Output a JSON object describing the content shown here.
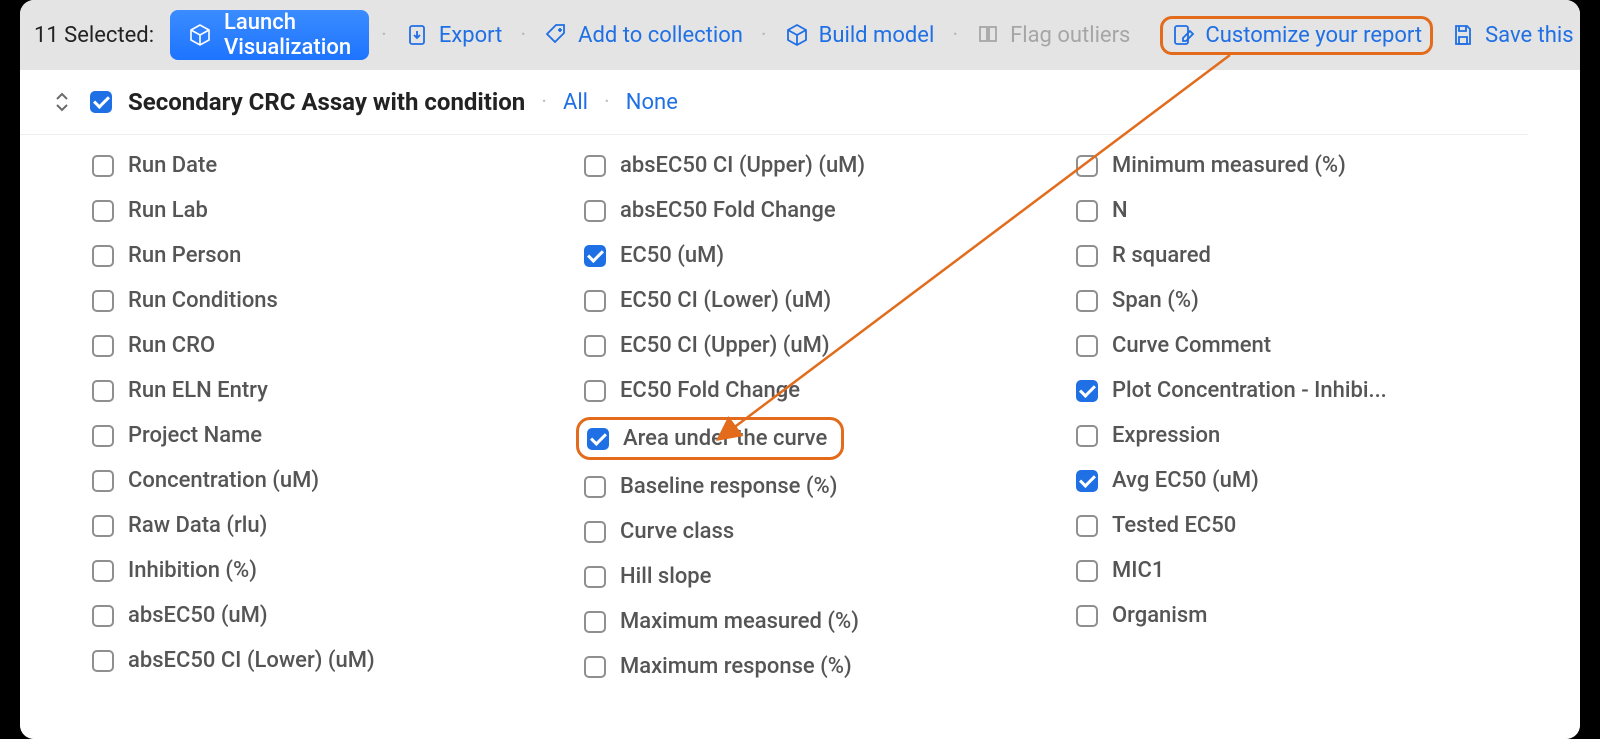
{
  "toolbar": {
    "selected_count": "11 Selected:",
    "launch": "Launch Visualization",
    "export": "Export",
    "add_collection": "Add to collection",
    "build_model": "Build model",
    "flag_outliers": "Flag outliers",
    "customize": "Customize your report",
    "save_search": "Save this search"
  },
  "section": {
    "title": "Secondary CRC Assay with condition",
    "all": "All",
    "none": "None",
    "checked": true
  },
  "cols": [
    [
      {
        "label": "Run Date",
        "checked": false
      },
      {
        "label": "Run Lab",
        "checked": false
      },
      {
        "label": "Run Person",
        "checked": false
      },
      {
        "label": "Run Conditions",
        "checked": false
      },
      {
        "label": "Run CRO",
        "checked": false
      },
      {
        "label": "Run ELN Entry",
        "checked": false
      },
      {
        "label": "Project Name",
        "checked": false
      },
      {
        "label": "Concentration (uM)",
        "checked": false
      },
      {
        "label": "Raw Data (rlu)",
        "checked": false
      },
      {
        "label": "Inhibition (%)",
        "checked": false
      },
      {
        "label": "absEC50 (uM)",
        "checked": false
      },
      {
        "label": "absEC50 CI (Lower) (uM)",
        "checked": false
      }
    ],
    [
      {
        "label": "absEC50 CI (Upper) (uM)",
        "checked": false
      },
      {
        "label": "absEC50 Fold Change",
        "checked": false
      },
      {
        "label": "EC50 (uM)",
        "checked": true
      },
      {
        "label": "EC50 CI (Lower) (uM)",
        "checked": false
      },
      {
        "label": "EC50 CI (Upper) (uM)",
        "checked": false
      },
      {
        "label": "EC50 Fold Change",
        "checked": false
      },
      {
        "label": "Area under the curve",
        "checked": true,
        "highlight": true
      },
      {
        "label": "Baseline response (%)",
        "checked": false
      },
      {
        "label": "Curve class",
        "checked": false
      },
      {
        "label": "Hill slope",
        "checked": false
      },
      {
        "label": "Maximum measured (%)",
        "checked": false
      },
      {
        "label": "Maximum response (%)",
        "checked": false
      }
    ],
    [
      {
        "label": "Minimum measured (%)",
        "checked": false
      },
      {
        "label": "N",
        "checked": false
      },
      {
        "label": "R squared",
        "checked": false
      },
      {
        "label": "Span (%)",
        "checked": false
      },
      {
        "label": "Curve Comment",
        "checked": false
      },
      {
        "label": "Plot Concentration - Inhibi...",
        "checked": true
      },
      {
        "label": "Expression",
        "checked": false
      },
      {
        "label": "Avg EC50 (uM)",
        "checked": true
      },
      {
        "label": "Tested EC50",
        "checked": false
      },
      {
        "label": "MIC1",
        "checked": false
      },
      {
        "label": "Organism",
        "checked": false
      }
    ]
  ]
}
